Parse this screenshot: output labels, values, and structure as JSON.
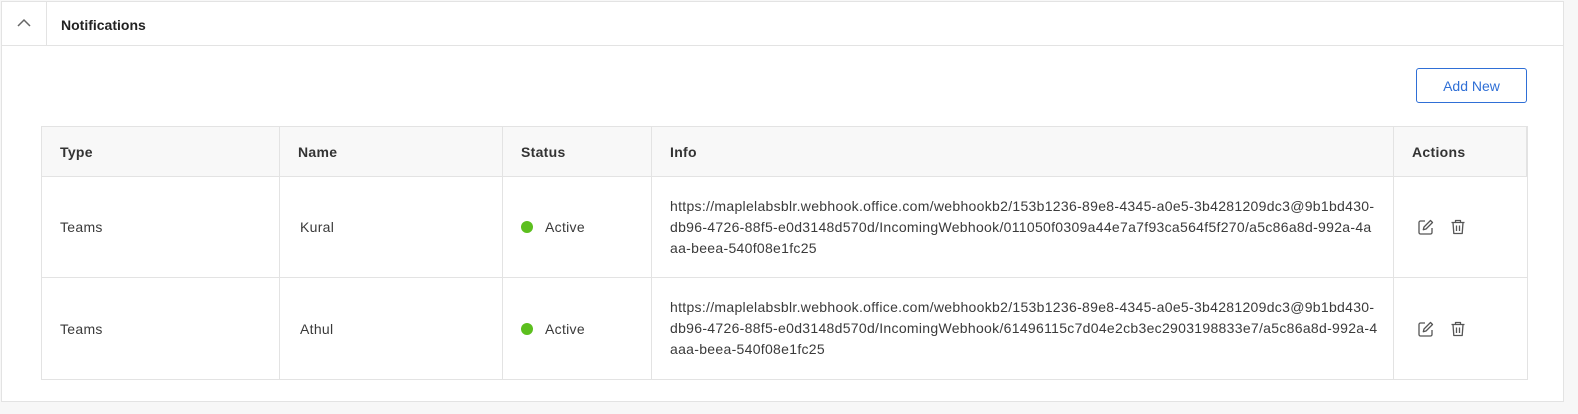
{
  "panel": {
    "title": "Notifications",
    "collapse_icon": "chevron-up-icon"
  },
  "toolbar": {
    "add_new_label": "Add New",
    "accent_color": "#2f6fd6"
  },
  "table": {
    "columns": {
      "type": "Type",
      "name": "Name",
      "status": "Status",
      "info": "Info",
      "actions": "Actions"
    },
    "rows": [
      {
        "type": "Teams",
        "name": "Kural",
        "status": "Active",
        "status_color": "#5cbf1e",
        "info": "https://maplelabsblr.webhook.office.com/webhookb2/153b1236-89e8-4345-a0e5-3b4281209dc3@9b1bd430-db96-4726-88f5-e0d3148d570d/IncomingWebhook/011050f0309a44e7a7f93ca564f5f270/a5c86a8d-992a-4aaa-beea-540f08e1fc25",
        "actions": [
          "edit-icon",
          "trash-icon"
        ]
      },
      {
        "type": "Teams",
        "name": "Athul",
        "status": "Active",
        "status_color": "#5cbf1e",
        "info": "https://maplelabsblr.webhook.office.com/webhookb2/153b1236-89e8-4345-a0e5-3b4281209dc3@9b1bd430-db96-4726-88f5-e0d3148d570d/IncomingWebhook/61496115c7d04e2cb3ec2903198833e7/a5c86a8d-992a-4aaa-beea-540f08e1fc25",
        "actions": [
          "edit-icon",
          "trash-icon"
        ]
      }
    ]
  }
}
